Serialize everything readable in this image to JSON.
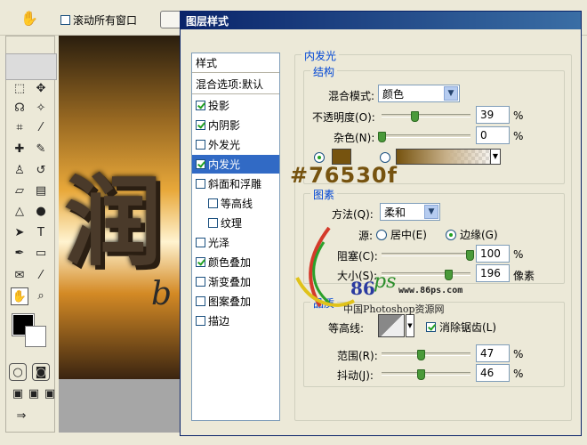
{
  "topbar": {
    "scroll_all_windows": "滚动所有窗口",
    "scroll_all_checked": false
  },
  "dialog": {
    "title": "图层样式",
    "styles_header": "样式",
    "blend_options": "混合选项:默认",
    "styles": [
      {
        "label": "投影",
        "checked": true
      },
      {
        "label": "内阴影",
        "checked": true
      },
      {
        "label": "外发光",
        "checked": false
      },
      {
        "label": "内发光",
        "checked": true,
        "selected": true
      },
      {
        "label": "斜面和浮雕",
        "checked": false
      },
      {
        "label": "等高线",
        "checked": false,
        "indent": true
      },
      {
        "label": "纹理",
        "checked": false,
        "indent": true
      },
      {
        "label": "光泽",
        "checked": false
      },
      {
        "label": "颜色叠加",
        "checked": true
      },
      {
        "label": "渐变叠加",
        "checked": false
      },
      {
        "label": "图案叠加",
        "checked": false
      },
      {
        "label": "描边",
        "checked": false
      }
    ],
    "panel_title": "内发光",
    "structure": {
      "legend": "结构",
      "blend_mode_label": "混合模式:",
      "blend_mode": "颜色",
      "opacity_label": "不透明度(O):",
      "opacity": "39",
      "noise_label": "杂色(N):",
      "noise": "0",
      "percent": "%",
      "color_hex": "#76530f"
    },
    "elements": {
      "legend": "图素",
      "method_label": "方法(Q):",
      "method": "柔和",
      "source_label": "源:",
      "source_center": "居中(E)",
      "source_edge": "边缘(G)",
      "choke_label": "阻塞(C):",
      "choke": "100",
      "size_label": "大小(S):",
      "size": "196",
      "px": "像素"
    },
    "quality": {
      "legend": "品质",
      "contour_label": "等高线:",
      "antialias": "消除锯齿(L)",
      "range_label": "范围(R):",
      "range": "47",
      "jitter_label": "抖动(J):",
      "jitter": "46"
    }
  },
  "overlay": {
    "hex_annotation": "#76530f",
    "watermark_86": "86",
    "watermark_ps": "ps",
    "watermark_url": "www.86ps.com",
    "watermark_cn": "中国Photoshop资源网"
  },
  "canvas": {
    "glyph": "润",
    "glyph2": "b"
  },
  "colors": {
    "selection": "#316ac5",
    "glow": "#76530f",
    "titlebar": "#0a246a"
  }
}
